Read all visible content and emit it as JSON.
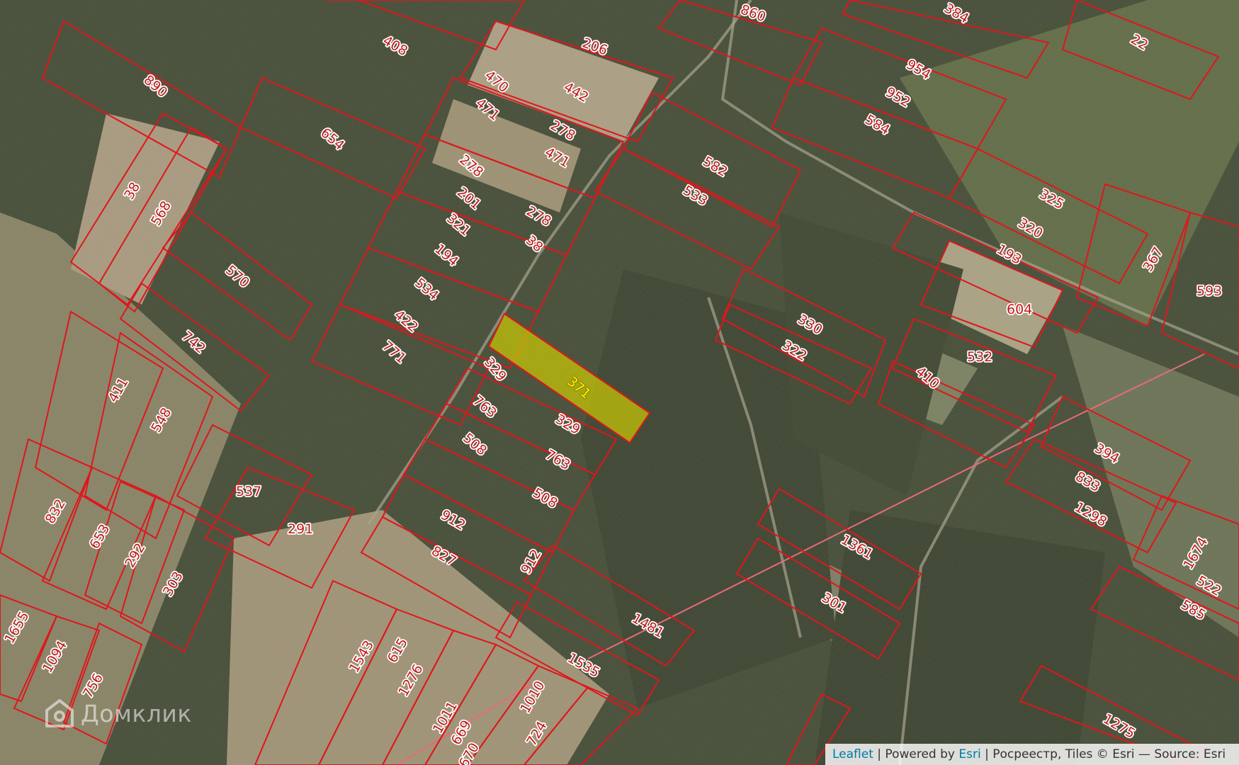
{
  "map": {
    "selected_parcel": "371",
    "parcel_labels": [
      "408",
      "206",
      "860",
      "384",
      "22",
      "890",
      "470",
      "442",
      "954",
      "471",
      "952",
      "654",
      "278",
      "316",
      "584",
      "38",
      "201",
      "582",
      "568",
      "533",
      "325",
      "321",
      "320",
      "194",
      "193",
      "367",
      "570",
      "593",
      "534",
      "604",
      "330",
      "422",
      "322",
      "742",
      "532",
      "329",
      "771",
      "410",
      "411",
      "548",
      "763",
      "508",
      "394",
      "833",
      "537",
      "1298",
      "832",
      "291",
      "912",
      "1361",
      "653",
      "292",
      "827",
      "1674",
      "303",
      "522",
      "301",
      "585",
      "1481",
      "1655",
      "1094",
      "1543",
      "615",
      "1535",
      "756",
      "1276",
      "1010",
      "1011",
      "669",
      "724",
      "1275",
      "670"
    ]
  },
  "watermark": {
    "text": "Домклик"
  },
  "attribution": {
    "leaflet": "Leaflet",
    "powered_by": "| Powered by",
    "esri": "Esri",
    "rest": "| Росреестр, Tiles © Esri — Source: Esri"
  },
  "colors": {
    "parcel_border": "#e0161c",
    "selected_fill": "#d7d400",
    "label": "#c01a1a"
  }
}
